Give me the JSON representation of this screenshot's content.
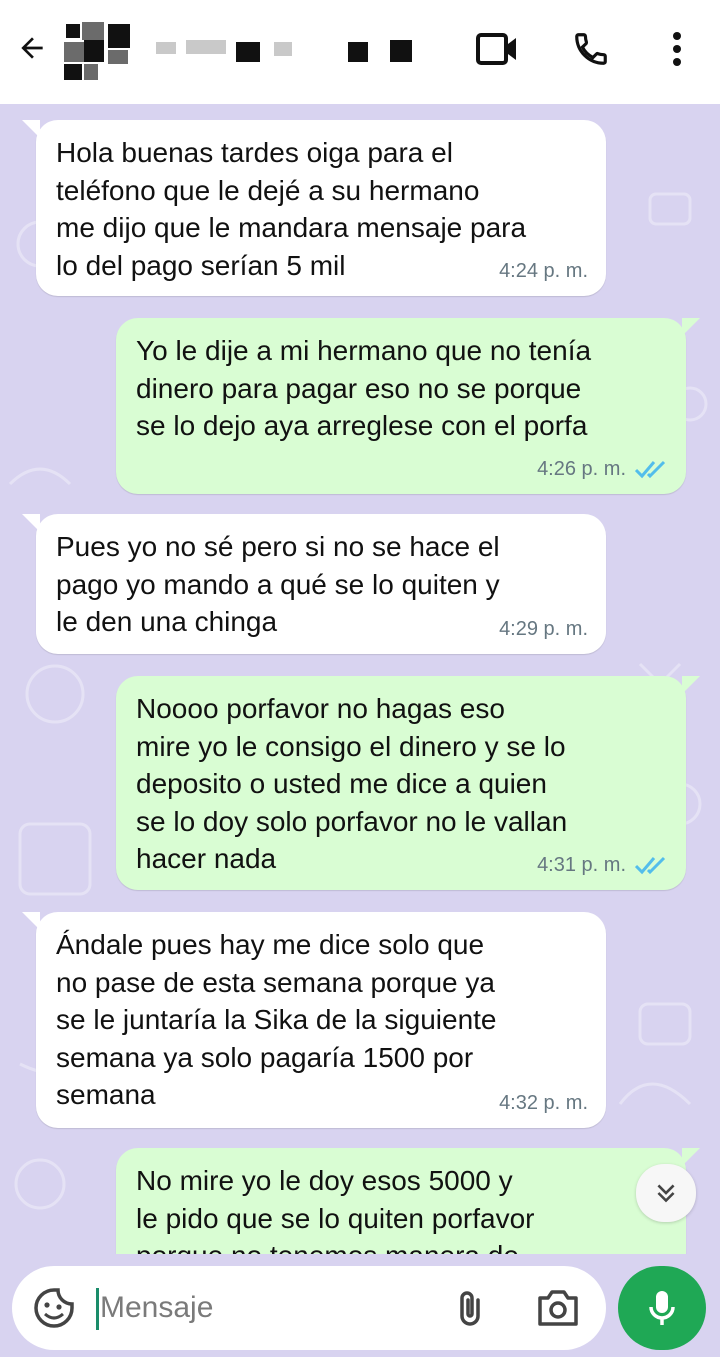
{
  "header": {
    "back_icon": "arrow-left-icon",
    "contact_name_redacted": true,
    "actions": [
      "video-call-icon",
      "phone-icon",
      "more-vert-icon"
    ]
  },
  "messages": [
    {
      "direction": "in",
      "text": "Hola buenas tardes oiga para el\nteléfono que le dejé a su hermano\nme dijo que le mandara mensaje para\nlo del pago serían 5 mil",
      "time": "4:24 p. m."
    },
    {
      "direction": "out",
      "text": "Yo le dije a mi hermano que no tenía\ndinero para pagar eso no se porque\nse lo dejo aya arreglese con el porfa",
      "time": "4:26 p. m.",
      "status": "read"
    },
    {
      "direction": "in",
      "text": "Pues yo no sé pero si no se hace el\npago yo mando a qué se lo quiten y\nle den una chinga",
      "time": "4:29 p. m."
    },
    {
      "direction": "out",
      "text": "Noooo porfavor no hagas eso\nmire yo le consigo el dinero y se lo\ndeposito o usted me dice a quien\nse lo doy solo porfavor no le vallan\nhacer nada",
      "time": "4:31 p. m.",
      "status": "read"
    },
    {
      "direction": "in",
      "text": "Ándale pues hay me dice solo que\nno pase de esta semana porque ya\nse le juntaría la Sika de la siguiente\nsemana ya solo pagaría 1500 por\nsemana",
      "time": "4:32 p. m."
    },
    {
      "direction": "out",
      "text": "No mire yo le doy esos 5000 y\nle pido que se lo quiten porfavor\nporque no tenemos manera de",
      "time": "",
      "status": "partial"
    }
  ],
  "composer": {
    "placeholder": "Mensaje"
  },
  "colors": {
    "header_bg": "#ffffff",
    "chat_bg": "#d8d3f0",
    "incoming_bubble": "#ffffff",
    "outgoing_bubble": "#d9fdd3",
    "read_ticks": "#53bdeb",
    "mic_button": "#1fa855"
  }
}
